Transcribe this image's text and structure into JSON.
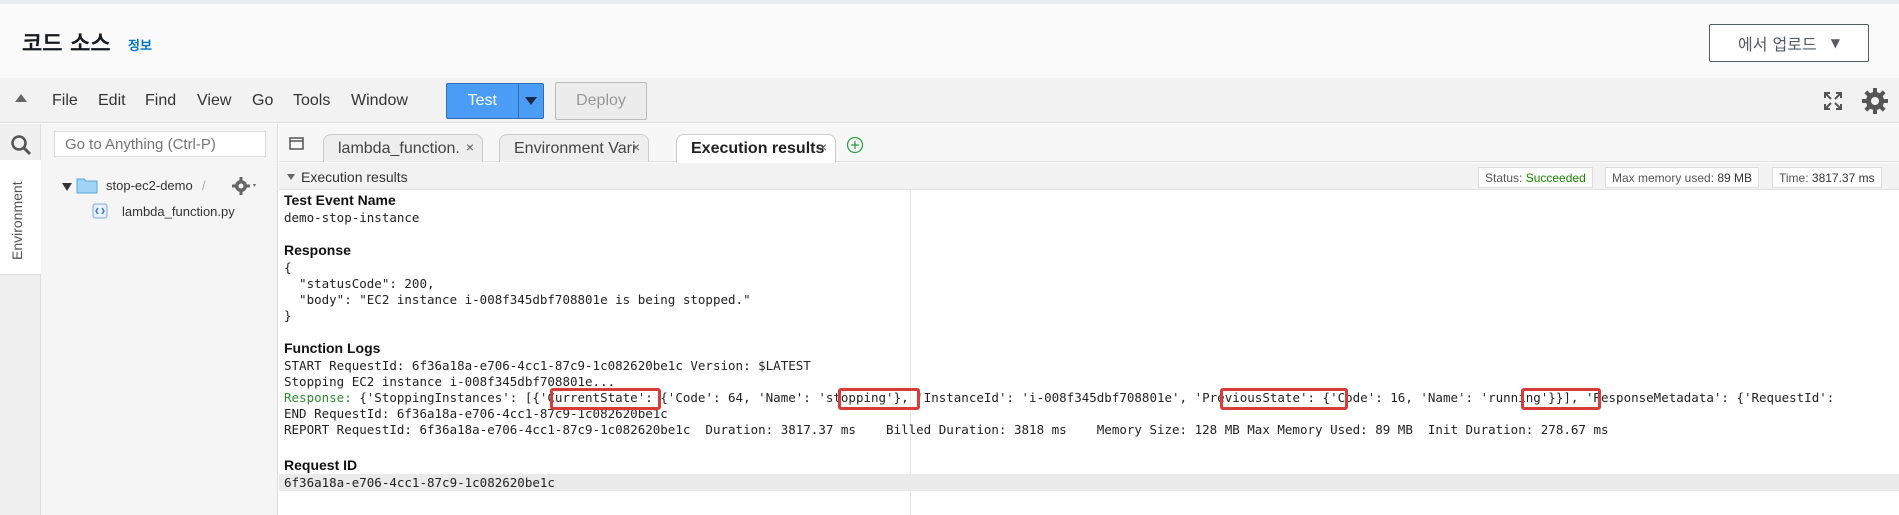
{
  "header": {
    "title": "코드 소스",
    "info_link": "정보",
    "upload_button": "에서 업로드"
  },
  "menubar": {
    "items": [
      "File",
      "Edit",
      "Find",
      "View",
      "Go",
      "Tools",
      "Window"
    ],
    "test_label": "Test",
    "deploy_label": "Deploy"
  },
  "left_panel": {
    "goto_placeholder": "Go to Anything (Ctrl-P)",
    "env_tab": "Environment",
    "folder": "stop-ec2-demo",
    "folder_sep": "/",
    "file": "lambda_function.py"
  },
  "tabs": [
    {
      "label": "lambda_function.",
      "close": "×"
    },
    {
      "label": "Environment Vari",
      "close": "×"
    },
    {
      "label": "Execution results",
      "close": "×"
    }
  ],
  "exec": {
    "title": "Execution results",
    "status_label": "Status:",
    "status_value": "Succeeded",
    "memory_label": "Max memory used:",
    "memory_value": "89 MB",
    "time_label": "Time:",
    "time_value": "3817.37 ms",
    "test_event_title": "Test Event Name",
    "test_event_name": "demo-stop-instance",
    "response_title": "Response",
    "response_lines": [
      "{",
      "  \"statusCode\": 200,",
      "  \"body\": \"EC2 instance i-008f345dbf708801e is being stopped.\"",
      "}"
    ],
    "logs_title": "Function Logs",
    "log_start": "START RequestId: 6f36a18a-e706-4cc1-87c9-1c082620be1c Version: $LATEST",
    "log_stopping": "Stopping EC2 instance i-008f345dbf708801e...",
    "log_response_prefix": "Response:",
    "log_response_body": " {'StoppingInstances': [{'CurrentState': {'Code': 64, 'Name': 'stopping'}, 'InstanceId': 'i-008f345dbf708801e', 'PreviousState': {'Code': 16, 'Name': 'running'}}], 'ResponseMetadata': {'RequestId':",
    "log_end": "END RequestId: 6f36a18a-e706-4cc1-87c9-1c082620be1c",
    "log_report": "REPORT RequestId: 6f36a18a-e706-4cc1-87c9-1c082620be1c  Duration: 3817.37 ms    Billed Duration: 3818 ms    Memory Size: 128 MB Max Memory Used: 89 MB  Init Duration: 278.67 ms",
    "request_id_title": "Request ID",
    "request_id": "6f36a18a-e706-4cc1-87c9-1c082620be1c"
  },
  "colors": {
    "primary": "#4a9cf5",
    "link": "#0073bb",
    "success": "#1d8102",
    "highlight": "#d93a3a"
  }
}
